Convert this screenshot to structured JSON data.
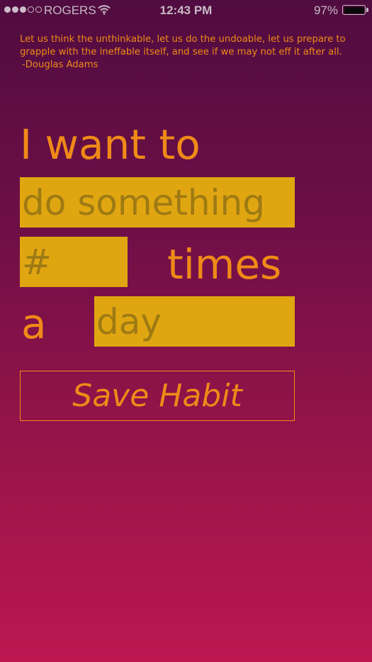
{
  "status_bar": {
    "carrier": "ROGERS",
    "time": "12:43 PM",
    "battery": "97%",
    "signal_bars_filled": 3,
    "signal_bars_total": 5
  },
  "quote": {
    "text": "Let us think the unthinkable, let us do the undoable, let us prepare to grapple with the ineffable itself, and see if we may not eff it after all.",
    "author": "-Douglas Adams"
  },
  "form": {
    "intro": "I want to",
    "action_placeholder": "do something",
    "count_placeholder": "#",
    "times_label": "times",
    "a_label": "a",
    "period_placeholder": "day",
    "save_label": "Save Habit"
  },
  "colors": {
    "accent": "#ef8a18",
    "field_background": "#e0a611",
    "placeholder": "#9e7a14",
    "gradient_top": "#500c40",
    "gradient_bottom": "#bd1750"
  }
}
